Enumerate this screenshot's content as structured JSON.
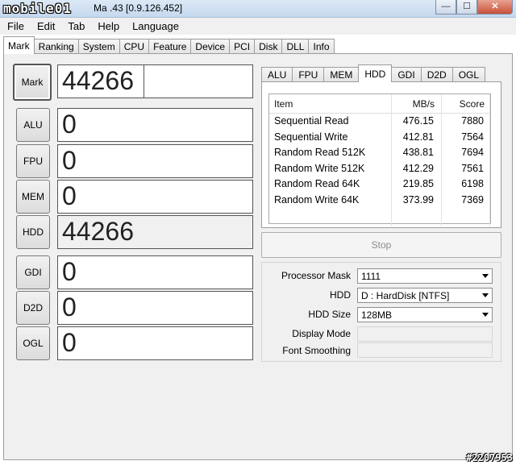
{
  "window": {
    "logo": "mobile01",
    "title_fragment": "Ma      .43 [0.9.126.452]",
    "minimize": "—",
    "maximize": "☐",
    "close": "✕"
  },
  "menu": [
    "File",
    "Edit",
    "Tab",
    "Help",
    "Language"
  ],
  "main_tabs": [
    "Mark",
    "Ranking",
    "System",
    "CPU",
    "Feature",
    "Device",
    "PCI",
    "Disk",
    "DLL",
    "Info"
  ],
  "left": {
    "mark": {
      "label": "Mark",
      "score": "44266"
    },
    "rows": [
      {
        "label": "ALU",
        "score": "0"
      },
      {
        "label": "FPU",
        "score": "0"
      },
      {
        "label": "MEM",
        "score": "0"
      },
      {
        "label": "HDD",
        "score": "44266"
      },
      {
        "label": "GDI",
        "score": "0"
      },
      {
        "label": "D2D",
        "score": "0"
      },
      {
        "label": "OGL",
        "score": "0"
      }
    ]
  },
  "sub_tabs": [
    "ALU",
    "FPU",
    "MEM",
    "HDD",
    "GDI",
    "D2D",
    "OGL"
  ],
  "table": {
    "headers": [
      "Item",
      "MB/s",
      "Score"
    ],
    "rows": [
      [
        "Sequential Read",
        "476.15",
        "7880"
      ],
      [
        "Sequential Write",
        "412.81",
        "7564"
      ],
      [
        "Random Read 512K",
        "438.81",
        "7694"
      ],
      [
        "Random Write 512K",
        "412.29",
        "7561"
      ],
      [
        "Random Read 64K",
        "219.85",
        "6198"
      ],
      [
        "Random Write 64K",
        "373.99",
        "7369"
      ]
    ]
  },
  "stop_label": "Stop",
  "settings": {
    "processor_mask_label": "Processor Mask",
    "processor_mask_value": "1111",
    "hdd_label": "HDD",
    "hdd_value": "D : HardDisk [NTFS]",
    "hdd_size_label": "HDD Size",
    "hdd_size_value": "128MB",
    "display_mode_label": "Display Mode",
    "font_smoothing_label": "Font Smoothing"
  },
  "watermark": "#2207953"
}
